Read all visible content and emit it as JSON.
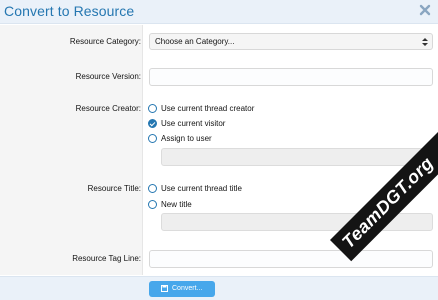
{
  "dialog": {
    "title": "Convert to Resource",
    "close_icon": "close-icon"
  },
  "fields": {
    "category": {
      "label": "Resource Category:",
      "selected": "Choose an Category..."
    },
    "version": {
      "label": "Resource Version:",
      "value": ""
    },
    "creator": {
      "label": "Resource Creator:",
      "options": [
        "Use current thread creator",
        "Use current visitor",
        "Assign to user"
      ],
      "selected_index": 1,
      "user_value": ""
    },
    "title": {
      "label": "Resource Title:",
      "options": [
        "Use current thread title",
        "New title"
      ],
      "new_title_value": ""
    },
    "tagline": {
      "label": "Resource Tag Line:",
      "value": ""
    }
  },
  "footer": {
    "convert_label": "Convert...",
    "convert_icon": "save-icon"
  },
  "watermark": "TeamDGT.org",
  "colors": {
    "accent": "#2577b1",
    "button": "#47a7eb",
    "header_bg": "#eaf1f9"
  }
}
